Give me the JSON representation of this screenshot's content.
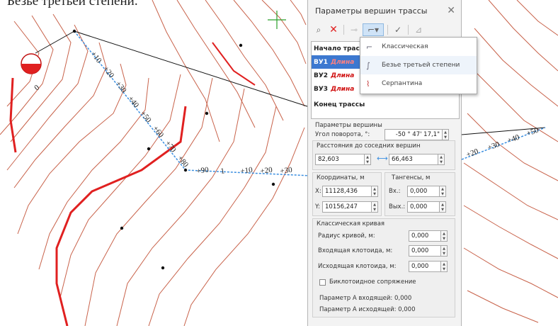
{
  "page": {
    "caption": "Безье третьей степени."
  },
  "colors": {
    "contour": "#c8624a",
    "trace_red": "#e02020",
    "trace_blue": "#3a8ee0",
    "selection": "#3c78d0",
    "crosshair": "#2aa02a"
  },
  "map": {
    "stations_left": [
      "+10",
      "+20",
      "+30",
      "+40",
      "+50",
      "+60",
      "+70",
      "+80"
    ],
    "stations_mid": [
      "+90",
      "1",
      "+10",
      "+20",
      "+30"
    ],
    "stations_right": [
      "+20",
      "+30",
      "+40",
      "+50"
    ],
    "zero_label": "0"
  },
  "panel": {
    "title": "Параметры вершин трассы",
    "close_icon": "close-icon",
    "toolbar": {
      "find_icon": "binoculars-icon",
      "delete_icon": "delete-x-icon",
      "link_icon": "link-icon",
      "curve_type_icon": "curve-type-icon",
      "check_icon": "check-icon",
      "measure_icon": "measure-icon"
    },
    "list": {
      "start": "Начало трас",
      "items": [
        {
          "name": "ВУ1",
          "len": "Длина"
        },
        {
          "name": "ВУ2",
          "len": "Длина"
        },
        {
          "name": "ВУ3",
          "len": "Длина"
        }
      ],
      "end": "Конец трассы"
    },
    "vertex_params": {
      "section": "Параметры вершины",
      "angle_label": "Угол поворота, °:",
      "angle_value": "-50 °  47' 17,1\""
    },
    "distances": {
      "section": "Расстояния до соседних вершин",
      "left_value": "82,603",
      "right_value": "66,463"
    },
    "coords": {
      "section": "Координаты, м",
      "x_label": "X:",
      "x_value": "11128,436",
      "y_label": "Y:",
      "y_value": "10156,247"
    },
    "tangents": {
      "section": "Тангенсы, м",
      "in_label": "Вх.:",
      "in_value": "0,000",
      "out_label": "Вых.:",
      "out_value": "0,000"
    },
    "curve": {
      "section": "Классическая кривая",
      "radius_label": "Радиус кривой, м:",
      "radius_value": "0,000",
      "in_clothoid_label": "Входящая клотоида, м:",
      "in_clothoid_value": "0,000",
      "out_clothoid_label": "Исходящая клотоида, м:",
      "out_clothoid_value": "0,000",
      "biclothoid_label": "Биклотоидное сопряжение",
      "param_in": "Параметр А входящей: 0,000",
      "param_out": "Параметр А исходящей: 0,000"
    },
    "dropdown": {
      "items": [
        {
          "label": "Классическая",
          "icon": "classic-curve-icon"
        },
        {
          "label": "Безье третьей степени",
          "icon": "bezier-curve-icon"
        },
        {
          "label": "Серпантина",
          "icon": "serpentine-curve-icon"
        }
      ]
    }
  }
}
